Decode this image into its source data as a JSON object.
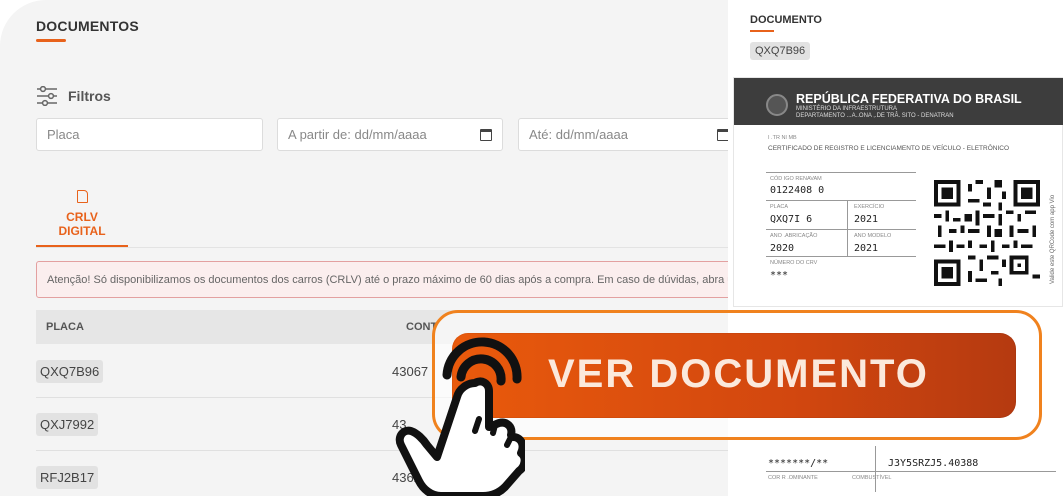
{
  "page": {
    "title": "DOCUMENTOS",
    "filters_label": "Filtros",
    "inputs": {
      "plate_placeholder": "Placa",
      "from_placeholder": "A partir de:  dd/mm/aaaa",
      "to_placeholder": "Até:  dd/mm/aaaa"
    },
    "tab": {
      "label_line1": "CRLV",
      "label_line2": "DIGITAL"
    },
    "alert": "Atenção! Só disponibilizamos os documentos dos carros (CRLV) até o prazo máximo de 60 dias após a compra. Em caso de dúvidas, abra u",
    "table": {
      "headers": {
        "plate": "PLACA",
        "contract": "CONT"
      },
      "rows": [
        {
          "plate": "QXQ7B96",
          "contract": "43067"
        },
        {
          "plate": "QXJ7992",
          "contract": "43"
        },
        {
          "plate": "RFJ2B17",
          "contract": "4362"
        }
      ]
    }
  },
  "document_panel": {
    "title": "DOCUMENTO",
    "plate": "QXQ7B96",
    "header_title": "REPÚBLICA FEDERATIVA DO BRASIL",
    "header_sub1": "MINISTÉRIO DA INFRAESTRUTURA",
    "header_sub2": "DEPARTAMENTO ...A..ONA  ,.DE TRÂ.  SITO - DENATRAN",
    "small_top": "I .TR NI MB",
    "doc_type": "CERTIFICADO DE REGISTRO E LICENCIAMENTO DE VEÍCULO - ELETRÔNICO",
    "fields": {
      "renavam_label": "CÓD IGO RENAVAM",
      "renavam_value": "0122408    0",
      "placa_label": "PLACA",
      "placa_value": "QXQ7I   6",
      "exercicio_label": "EXERCÍCIO",
      "exercicio_value": "2021",
      "ano_fab_label": "ANO  .ABRICAÇÃO",
      "ano_fab_value": "2020",
      "ano_modelo_label": "ANO MODELO",
      "ano_modelo_value": "2021",
      "crv_label": "NÚMERO DO CRV",
      "crv_value": "***"
    },
    "qr_note": "Valide este QRCode com app Vio",
    "bottom_left_value": "*******/**",
    "bottom_right_value": "J3Y5SRZJ5.40388",
    "bottom_left_label": "COR  R  .OMINANTE",
    "bottom_right_label": "COMBUSTÍVEL"
  },
  "cta": {
    "label": "VER DOCUMENTO"
  },
  "colors": {
    "accent": "#e8621b",
    "cta_start": "#e95a0c",
    "cta_end": "#b53a10"
  }
}
